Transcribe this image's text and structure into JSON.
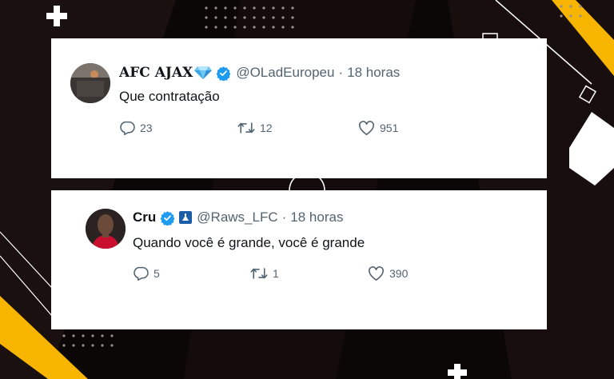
{
  "colors": {
    "background": "#0b0707",
    "accent_yellow": "#f7b500",
    "verified_blue": "#1d9bf0",
    "muted_text": "#536471",
    "primary_text": "#0f1419"
  },
  "tweets": [
    {
      "name": "AFC AJAX",
      "name_emoji_icon": "diamond-icon",
      "verified": true,
      "handle": "@OLadEuropeu",
      "separator": "·",
      "time": "18 horas",
      "text": "Que contratação",
      "replies": "23",
      "retweets": "12",
      "likes": "951"
    },
    {
      "name": "Cru",
      "verified": true,
      "affiliate_badge_icon": "club-crest-icon",
      "handle": "@Raws_LFC",
      "separator": "·",
      "time": "18 horas",
      "text": "Quando você é grande, você é grande",
      "replies": "5",
      "retweets": "1",
      "likes": "390"
    }
  ]
}
